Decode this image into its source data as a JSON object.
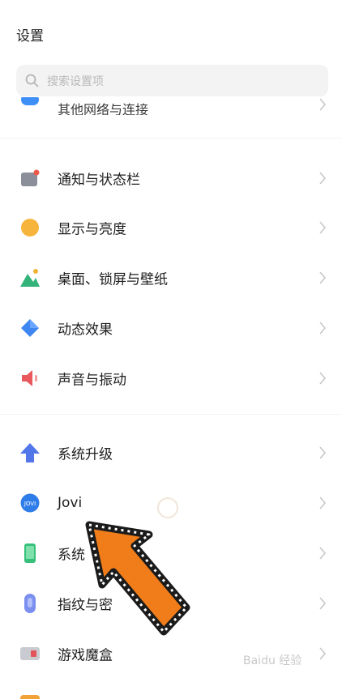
{
  "page_title": "设置",
  "search": {
    "placeholder": "搜索设置项",
    "icon": "search-icon"
  },
  "rows": [
    {
      "label": "其他网络与连接",
      "icon": "network-icon"
    },
    {
      "label": "通知与状态栏",
      "icon": "notification-icon"
    },
    {
      "label": "显示与亮度",
      "icon": "brightness-icon"
    },
    {
      "label": "桌面、锁屏与壁纸",
      "icon": "wallpaper-icon"
    },
    {
      "label": "动态效果",
      "icon": "motion-effect-icon"
    },
    {
      "label": "声音与振动",
      "icon": "sound-icon"
    },
    {
      "label": "系统升级",
      "icon": "system-upgrade-icon"
    },
    {
      "label": "Jovi",
      "icon": "jovi-icon"
    },
    {
      "label": "系统",
      "icon": "system-icon"
    },
    {
      "label": "指纹与密",
      "icon": "fingerprint-icon"
    },
    {
      "label": "游戏魔盒",
      "icon": "game-box-icon"
    }
  ],
  "watermark": "Baidu 经验",
  "colors": {
    "background": "#ffffff",
    "chevron": "#c8c8c8",
    "arrow_fill": "#f07d1a"
  }
}
